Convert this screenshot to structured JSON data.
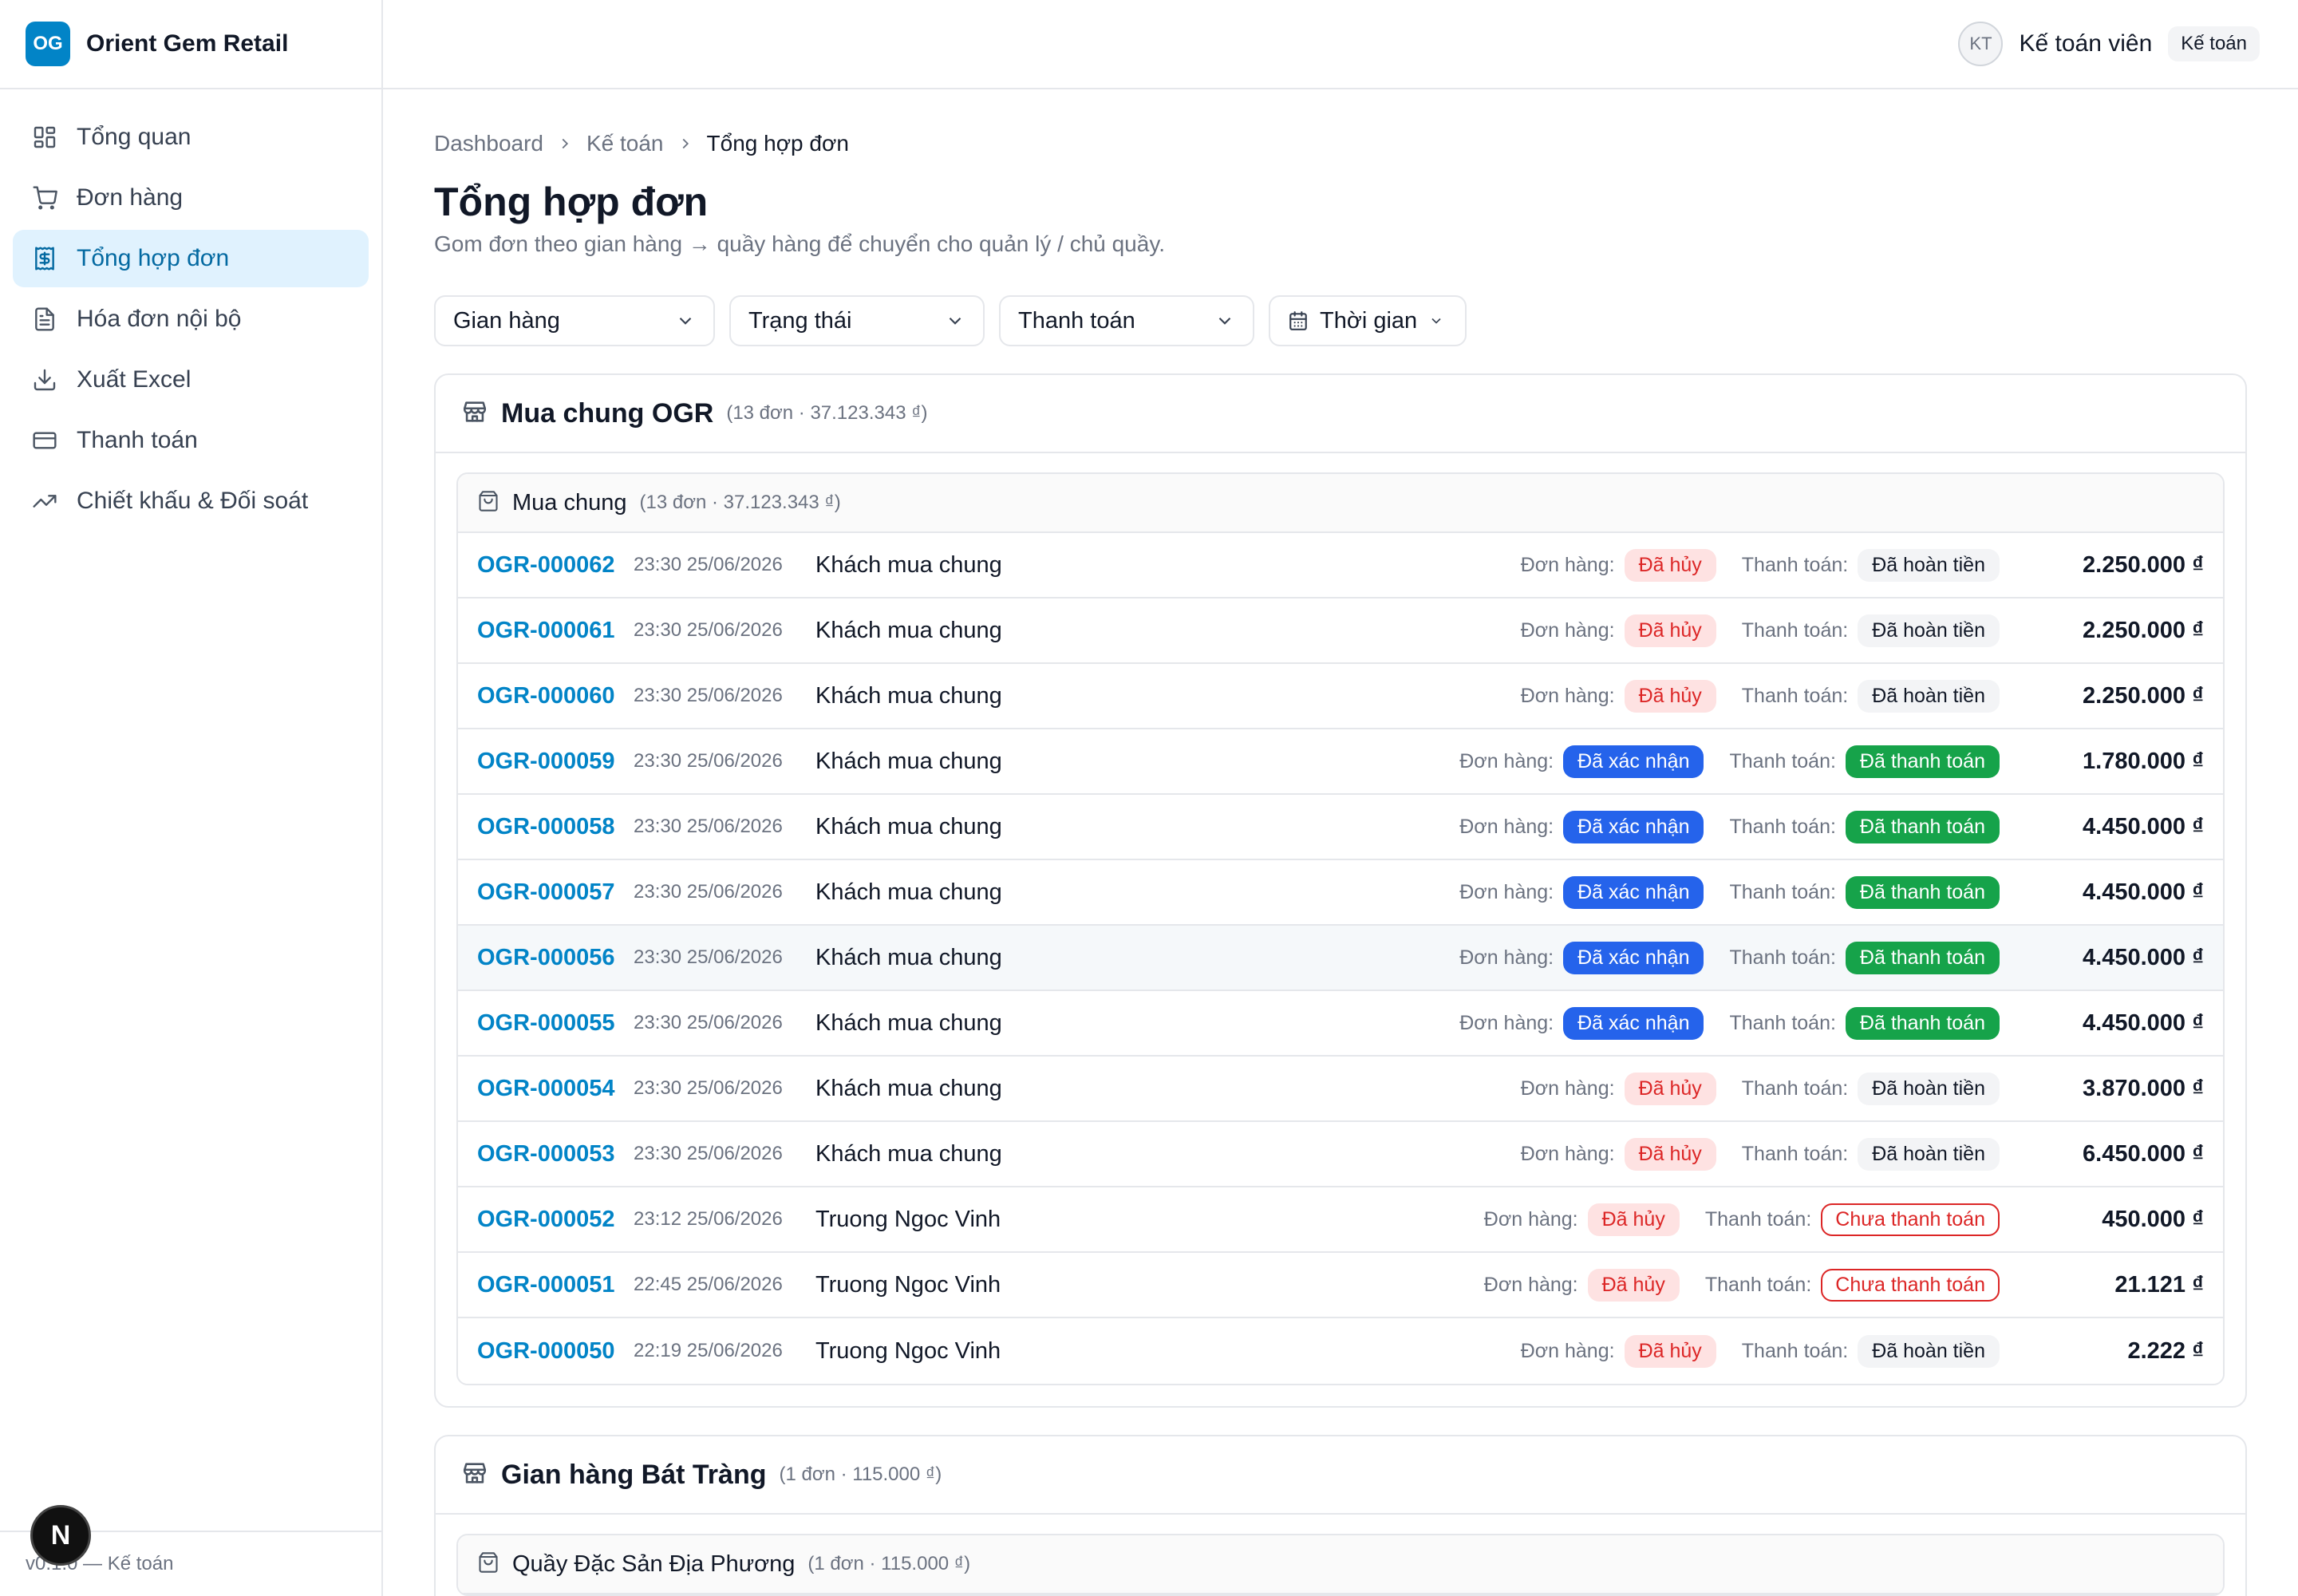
{
  "brand": {
    "logo": "OG",
    "name": "Orient Gem Retail"
  },
  "sidebar": {
    "items": [
      {
        "label": "Tổng quan",
        "icon": "dashboard-grid-icon"
      },
      {
        "label": "Đơn hàng",
        "icon": "cart-icon"
      },
      {
        "label": "Tổng hợp đơn",
        "icon": "receipt-dollar-icon",
        "active": true
      },
      {
        "label": "Hóa đơn nội bộ",
        "icon": "file-text-icon"
      },
      {
        "label": "Xuất Excel",
        "icon": "download-icon"
      },
      {
        "label": "Thanh toán",
        "icon": "credit-card-icon"
      },
      {
        "label": "Chiết khấu & Đối soát",
        "icon": "trending-up-icon"
      }
    ],
    "footer": "v0.1.0 — Kế toán",
    "next_badge": "N"
  },
  "header": {
    "avatar": "KT",
    "user_name": "Kế toán viên",
    "role": "Kế toán"
  },
  "breadcrumb": {
    "items": [
      "Dashboard",
      "Kế toán"
    ],
    "current": "Tổng hợp đơn"
  },
  "page": {
    "title": "Tổng hợp đơn",
    "subtitle": "Gom đơn theo gian hàng → quầy hàng để chuyển cho quản lý / chủ quầy."
  },
  "filters": {
    "store": "Gian hàng",
    "status": "Trạng thái",
    "payment": "Thanh toán",
    "time": "Thời gian"
  },
  "labels": {
    "order_status": "Đơn hàng:",
    "payment_status": "Thanh toán:"
  },
  "colors": {
    "accent": "#0284c7",
    "confirmed": "#2563eb",
    "paid": "#16a34a",
    "cancelled": "#dc2626"
  },
  "stores": [
    {
      "name": "Mua chung OGR",
      "meta": "(13 đơn · 37.123.343 ₫)",
      "counter": {
        "name": "Mua chung",
        "meta": "(13 đơn · 37.123.343 ₫)"
      },
      "orders": [
        {
          "id": "OGR-000062",
          "time": "23:30 25/06/2026",
          "customer": "Khách mua chung",
          "order_status": "Đã hủy",
          "payment_status": "Đã hoàn tiền",
          "amount": "2.250.000 ₫"
        },
        {
          "id": "OGR-000061",
          "time": "23:30 25/06/2026",
          "customer": "Khách mua chung",
          "order_status": "Đã hủy",
          "payment_status": "Đã hoàn tiền",
          "amount": "2.250.000 ₫"
        },
        {
          "id": "OGR-000060",
          "time": "23:30 25/06/2026",
          "customer": "Khách mua chung",
          "order_status": "Đã hủy",
          "payment_status": "Đã hoàn tiền",
          "amount": "2.250.000 ₫"
        },
        {
          "id": "OGR-000059",
          "time": "23:30 25/06/2026",
          "customer": "Khách mua chung",
          "order_status": "Đã xác nhận",
          "payment_status": "Đã thanh toán",
          "amount": "1.780.000 ₫"
        },
        {
          "id": "OGR-000058",
          "time": "23:30 25/06/2026",
          "customer": "Khách mua chung",
          "order_status": "Đã xác nhận",
          "payment_status": "Đã thanh toán",
          "amount": "4.450.000 ₫"
        },
        {
          "id": "OGR-000057",
          "time": "23:30 25/06/2026",
          "customer": "Khách mua chung",
          "order_status": "Đã xác nhận",
          "payment_status": "Đã thanh toán",
          "amount": "4.450.000 ₫"
        },
        {
          "id": "OGR-000056",
          "time": "23:30 25/06/2026",
          "customer": "Khách mua chung",
          "order_status": "Đã xác nhận",
          "payment_status": "Đã thanh toán",
          "amount": "4.450.000 ₫"
        },
        {
          "id": "OGR-000055",
          "time": "23:30 25/06/2026",
          "customer": "Khách mua chung",
          "order_status": "Đã xác nhận",
          "payment_status": "Đã thanh toán",
          "amount": "4.450.000 ₫"
        },
        {
          "id": "OGR-000054",
          "time": "23:30 25/06/2026",
          "customer": "Khách mua chung",
          "order_status": "Đã hủy",
          "payment_status": "Đã hoàn tiền",
          "amount": "3.870.000 ₫"
        },
        {
          "id": "OGR-000053",
          "time": "23:30 25/06/2026",
          "customer": "Khách mua chung",
          "order_status": "Đã hủy",
          "payment_status": "Đã hoàn tiền",
          "amount": "6.450.000 ₫"
        },
        {
          "id": "OGR-000052",
          "time": "23:12 25/06/2026",
          "customer": "Truong Ngoc Vinh",
          "order_status": "Đã hủy",
          "payment_status": "Chưa thanh toán",
          "amount": "450.000 ₫"
        },
        {
          "id": "OGR-000051",
          "time": "22:45 25/06/2026",
          "customer": "Truong Ngoc Vinh",
          "order_status": "Đã hủy",
          "payment_status": "Chưa thanh toán",
          "amount": "21.121 ₫"
        },
        {
          "id": "OGR-000050",
          "time": "22:19 25/06/2026",
          "customer": "Truong Ngoc Vinh",
          "order_status": "Đã hủy",
          "payment_status": "Đã hoàn tiền",
          "amount": "2.222 ₫"
        }
      ]
    },
    {
      "name": "Gian hàng Bát Tràng",
      "meta": "(1 đơn · 115.000 ₫)",
      "counter": {
        "name": "Quầy Đặc Sản Địa Phương",
        "meta": "(1 đơn · 115.000 ₫)"
      },
      "orders": []
    }
  ]
}
